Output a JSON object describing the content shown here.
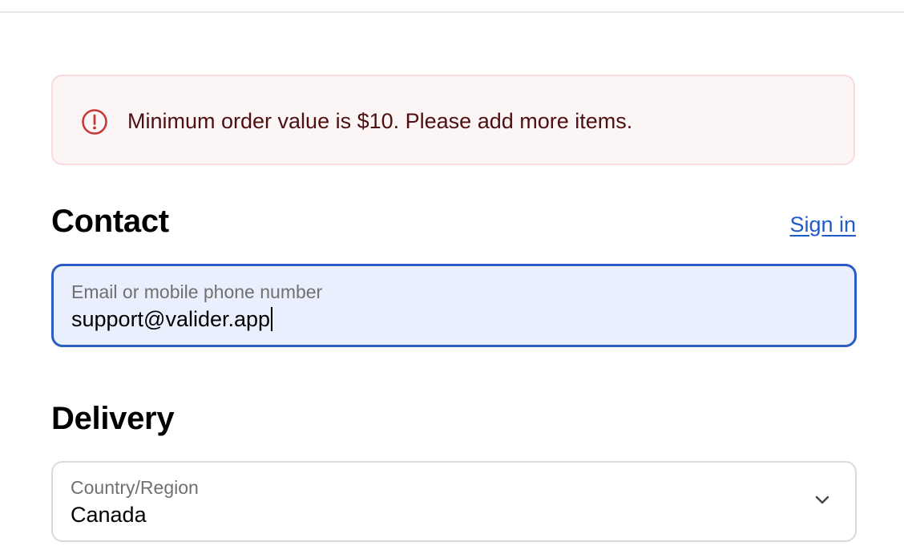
{
  "alert": {
    "icon": "error-circle-icon",
    "message": "Minimum order value is $10. Please add more items.",
    "colors": {
      "background": "#fcf5f5",
      "border": "#f6dcdc",
      "icon": "#c23a3a",
      "text": "#4d0f0f"
    }
  },
  "contact": {
    "title": "Contact",
    "sign_in_label": "Sign in",
    "email_field": {
      "label": "Email or mobile phone number",
      "value": "support@valider.app"
    }
  },
  "delivery": {
    "title": "Delivery",
    "country_field": {
      "label": "Country/Region",
      "value": "Canada",
      "icon": "chevron-down-icon"
    }
  },
  "colors": {
    "link": "#1f5cc7",
    "focus_border": "#2a5cc4",
    "focus_background": "#e9effd"
  }
}
